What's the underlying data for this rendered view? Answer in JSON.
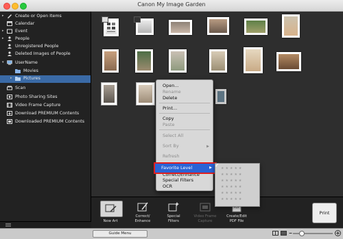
{
  "window": {
    "title": "Canon My Image Garden"
  },
  "sidebar": {
    "items": [
      {
        "label": "Create or Open Items",
        "arrow": "▸"
      },
      {
        "label": "Calendar",
        "arrow": ""
      },
      {
        "label": "Event",
        "arrow": "▸"
      },
      {
        "label": "People",
        "arrow": "▸"
      },
      {
        "label": "Unregistered People",
        "arrow": ""
      },
      {
        "label": "Deleted Images of People",
        "arrow": ""
      },
      {
        "label": "UserName",
        "arrow": "▾"
      },
      {
        "label": "Movies",
        "arrow": ""
      },
      {
        "label": "Pictures",
        "arrow": "▸"
      },
      {
        "label": "Scan",
        "arrow": ""
      },
      {
        "label": "Photo Sharing Sites",
        "arrow": ""
      },
      {
        "label": "Video Frame Capture",
        "arrow": ""
      },
      {
        "label": "Download PREMIUM Contents",
        "arrow": ""
      },
      {
        "label": "Downloaded PREMIUM Contents",
        "arrow": ""
      }
    ],
    "footer_icon": "menu-lines-icon"
  },
  "context_menu": {
    "items": [
      "Open...",
      "Rename",
      "Delete",
      "Print...",
      "Copy",
      "Paste",
      "Select All",
      "Sort By",
      "Refresh",
      "Favorite Level",
      "Correct/Enhance",
      "Special Filters",
      "OCR"
    ],
    "submenu_arrow": "▶",
    "check_mark": "✓",
    "star_rows": [
      "★★★★★",
      "★★★★★",
      "★★★★★",
      "★★★★★",
      "★★★★★",
      "★★★★★"
    ]
  },
  "toolbar": {
    "new_art": "New Art",
    "correct_1": "Correct/",
    "correct_2": "Enhance",
    "special_1": "Special",
    "special_2": "Filters",
    "video_1": "Video Frame",
    "video_2": "Capture",
    "create_1": "Create/Edit",
    "create_2": "PDF File",
    "print": "Print"
  },
  "status": {
    "guide_menu": "Guide Menu"
  },
  "colors": {
    "selection": "#3a6aa6",
    "highlight": "#2a63d6",
    "outline": "#e01d1d"
  }
}
